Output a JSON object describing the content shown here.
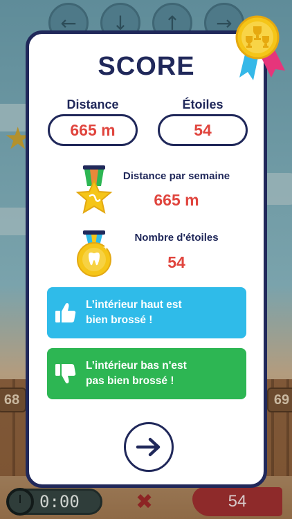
{
  "background": {
    "fence_left_number": "68",
    "fence_right_number": "69",
    "timer": "0:00",
    "red_score": "54"
  },
  "score": {
    "title": "SCORE",
    "distance_label": "Distance",
    "distance_value": "665 m",
    "stars_label": "Étoiles",
    "stars_value": "54"
  },
  "weekly": {
    "label": "Distance par semaine",
    "value": "665 m"
  },
  "star_count": {
    "label": "Nombre d'étoiles",
    "value": "54"
  },
  "tips": [
    {
      "text": "L’intérieur haut est\nbien brossé !",
      "kind": "thumb-up-icon",
      "color": "#2fbbe9"
    },
    {
      "text": "L’intérieur bas n'est\npas bien brossé !",
      "kind": "thumb-down-icon",
      "color": "#2db653"
    }
  ],
  "colors": {
    "navy": "#20285a",
    "value_red": "#e0453e",
    "gold": "#f5c518"
  }
}
